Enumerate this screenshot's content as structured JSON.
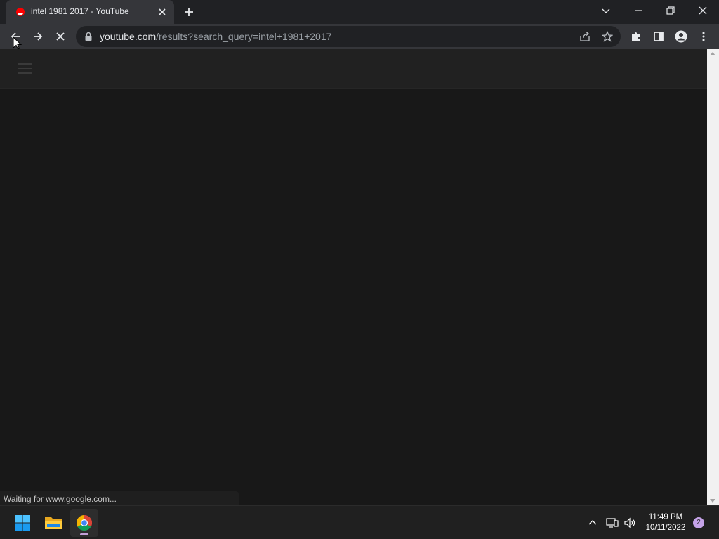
{
  "browser": {
    "tab": {
      "title": "intel 1981 2017 - YouTube",
      "favicon_icon": "youtube-favicon-icon"
    },
    "address_bar": {
      "url_host": "youtube.com",
      "url_path": "/results?search_query=intel+1981+2017"
    },
    "status_text": "Waiting for www.google.com..."
  },
  "taskbar": {
    "clock_time": "11:49 PM",
    "clock_date": "10/11/2022",
    "notification_count": "2"
  },
  "colors": {
    "tab_active": "#35363a",
    "page_background": "#181818",
    "youtube_red": "#ff0000"
  }
}
